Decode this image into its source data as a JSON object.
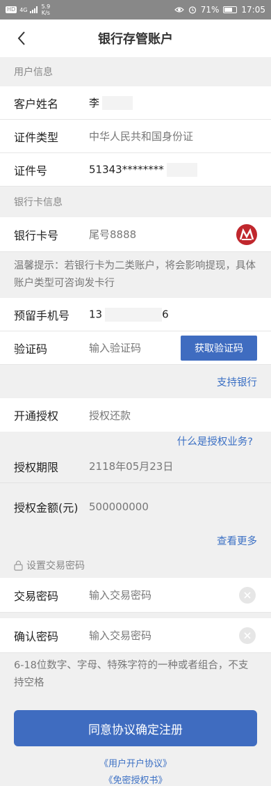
{
  "status_bar": {
    "left_chips": [
      "HD",
      "4G"
    ],
    "net_speed_value": "5.9",
    "net_speed_unit": "K/s",
    "battery_percent": "71%",
    "time": "17:05",
    "battery_fraction": 0.71
  },
  "nav": {
    "title": "银行存管账户"
  },
  "user_section": {
    "header": "用户信息",
    "name_label": "客户姓名",
    "name_value": "李",
    "id_type_label": "证件类型",
    "id_type_value": "中华人民共和国身份证",
    "id_number_label": "证件号",
    "id_number_value": "51343********"
  },
  "bank_section": {
    "header": "银行卡信息",
    "card_label": "银行卡号",
    "card_value": "尾号8888",
    "tip": "温馨提示：若银行卡为二类账户，将会影响提现，具体账户类型可咨询发卡行",
    "phone_label": "预留手机号",
    "phone_value_start": "13",
    "phone_value_end": "6",
    "code_label": "验证码",
    "code_placeholder": "输入验证码",
    "get_code_button": "获取验证码",
    "support_bank_link": "支持银行"
  },
  "auth_section": {
    "open_auth_label": "开通授权",
    "open_auth_value": "授权还款",
    "what_is_auth_link": "什么是授权业务?",
    "period_label": "授权期限",
    "period_value": "2118年05月23日",
    "amount_label": "授权金额(元)",
    "amount_value": "500000000",
    "see_more_link": "查看更多"
  },
  "password_section": {
    "header": "设置交易密码",
    "password_label": "交易密码",
    "password_placeholder": "输入交易密码",
    "confirm_label": "确认密码",
    "confirm_placeholder": "输入交易密码",
    "rule_text": "6-18位数字、字母、特殊字符的一种或者组合，不支持空格"
  },
  "footer": {
    "submit_button": "同意协议确定注册",
    "user_agreement_link": "《用户开户协议》",
    "auth_letter_link": "《免密授权书》"
  },
  "colors": {
    "accent": "#3f6cc0",
    "link": "#3a6fc4",
    "bank_logo": "#c0272d"
  }
}
